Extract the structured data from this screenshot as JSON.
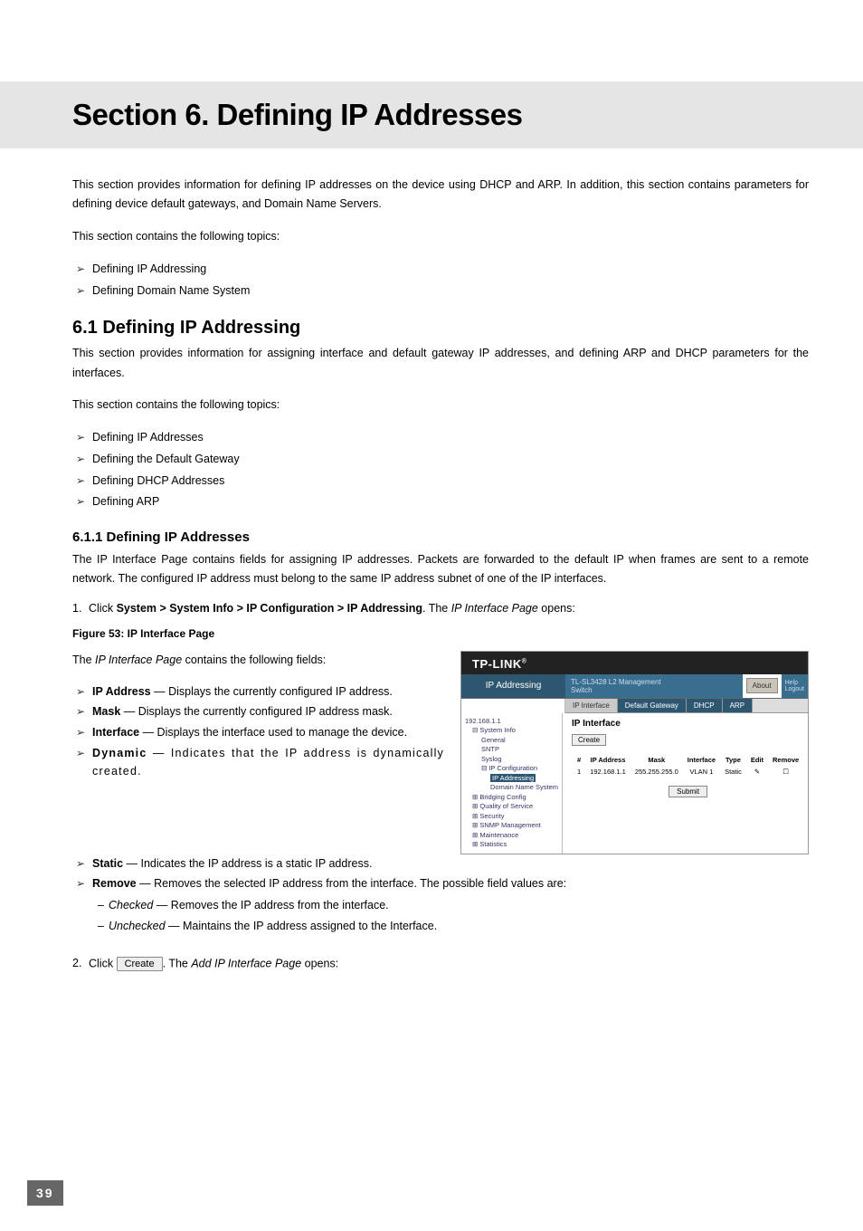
{
  "page_number": "39",
  "title": "Section 6.  Defining IP Addresses",
  "intro1": "This section provides information for defining IP addresses on the device using DHCP and ARP. In addition, this section contains parameters for defining device default gateways, and Domain Name Servers.",
  "intro2": "This section contains the following topics:",
  "top_bullets": [
    "Defining IP Addressing",
    "Defining Domain Name System"
  ],
  "h61": "6.1   Defining IP Addressing",
  "h61_p1": "This section provides information for assigning interface and default gateway IP addresses, and defining ARP and DHCP parameters for the interfaces.",
  "h61_p2": "This section contains the following topics:",
  "h61_bullets": [
    "Defining IP Addresses",
    "Defining the Default Gateway",
    "Defining DHCP Addresses",
    "Defining ARP"
  ],
  "h611": "6.1.1   Defining IP Addresses",
  "h611_p1": "The IP Interface Page contains fields for assigning IP addresses. Packets are forwarded to the default IP when frames are sent to a remote network. The configured IP address must belong to the same IP address subnet of one of the IP interfaces.",
  "step1_num": "1.",
  "step1_a": "Click ",
  "step1_b": "System > System Info > IP Configuration > IP Addressing",
  "step1_c": ". The ",
  "step1_d": "IP Interface Page",
  "step1_e": " opens:",
  "figcap": "Figure 53: IP Interface Page",
  "fields_intro_a": "The ",
  "fields_intro_b": "IP Interface Page",
  "fields_intro_c": " contains the following fields:",
  "fields": [
    {
      "name": "IP Address",
      "desc": " — Displays the currently configured IP address."
    },
    {
      "name": "Mask",
      "desc": " — Displays the currently configured IP address mask."
    },
    {
      "name": "Interface",
      "desc": " — Displays the interface used to manage the device."
    },
    {
      "name": "Dynamic",
      "desc": " — Indicates that the IP address is dynamically created."
    },
    {
      "name": "Static",
      "desc": " — Indicates the IP address is a static IP address."
    },
    {
      "name": "Remove",
      "desc": " — Removes the selected IP address from the interface. The possible field values are:"
    }
  ],
  "remove_sub": [
    {
      "name": "Checked",
      "desc": " — Removes the IP address from the interface."
    },
    {
      "name": "Unchecked",
      "desc": " — Maintains the IP address assigned to the Interface."
    }
  ],
  "step2_num": "2.",
  "step2_a": "Click ",
  "step2_btn": "Create",
  "step2_b": ". The ",
  "step2_c": "Add IP Interface Page",
  "step2_d": " opens:",
  "screenshot": {
    "brand": "TP-LINK",
    "header_left": "IP Addressing",
    "header_mid1": "TL-SL3428 L2 Management",
    "header_mid2": "Switch",
    "about": "About",
    "help": "Help",
    "logout": "Logout",
    "tabs": [
      "IP Interface",
      "Default Gateway",
      "DHCP",
      "ARP"
    ],
    "tree": [
      {
        "txt": "192.168.1.1",
        "cls": ""
      },
      {
        "txt": "⊟ System Info",
        "cls": "tree-indent-1"
      },
      {
        "txt": "General",
        "cls": "tree-indent-2"
      },
      {
        "txt": "SNTP",
        "cls": "tree-indent-2"
      },
      {
        "txt": "Syslog",
        "cls": "tree-indent-2"
      },
      {
        "txt": "⊟ IP Configuration",
        "cls": "tree-indent-2"
      },
      {
        "txt": "IP Addressing",
        "cls": "tree-indent-3 sel"
      },
      {
        "txt": "Domain Name System",
        "cls": "tree-indent-3"
      },
      {
        "txt": "⊞ Bridging Config",
        "cls": "tree-indent-1"
      },
      {
        "txt": "⊞ Quality of Service",
        "cls": "tree-indent-1"
      },
      {
        "txt": "⊞ Security",
        "cls": "tree-indent-1"
      },
      {
        "txt": "⊞ SNMP Management",
        "cls": "tree-indent-1"
      },
      {
        "txt": "⊞ Maintenance",
        "cls": "tree-indent-1"
      },
      {
        "txt": "⊞ Statistics",
        "cls": "tree-indent-1"
      }
    ],
    "main_title": "IP Interface",
    "create_btn": "Create",
    "table_headers": [
      "#",
      "IP Address",
      "Mask",
      "Interface",
      "Type",
      "Edit",
      "Remove"
    ],
    "table_row": [
      "1",
      "192.168.1.1",
      "255.255.255.0",
      "VLAN 1",
      "Static",
      "✎",
      "☐"
    ],
    "submit": "Submit"
  }
}
